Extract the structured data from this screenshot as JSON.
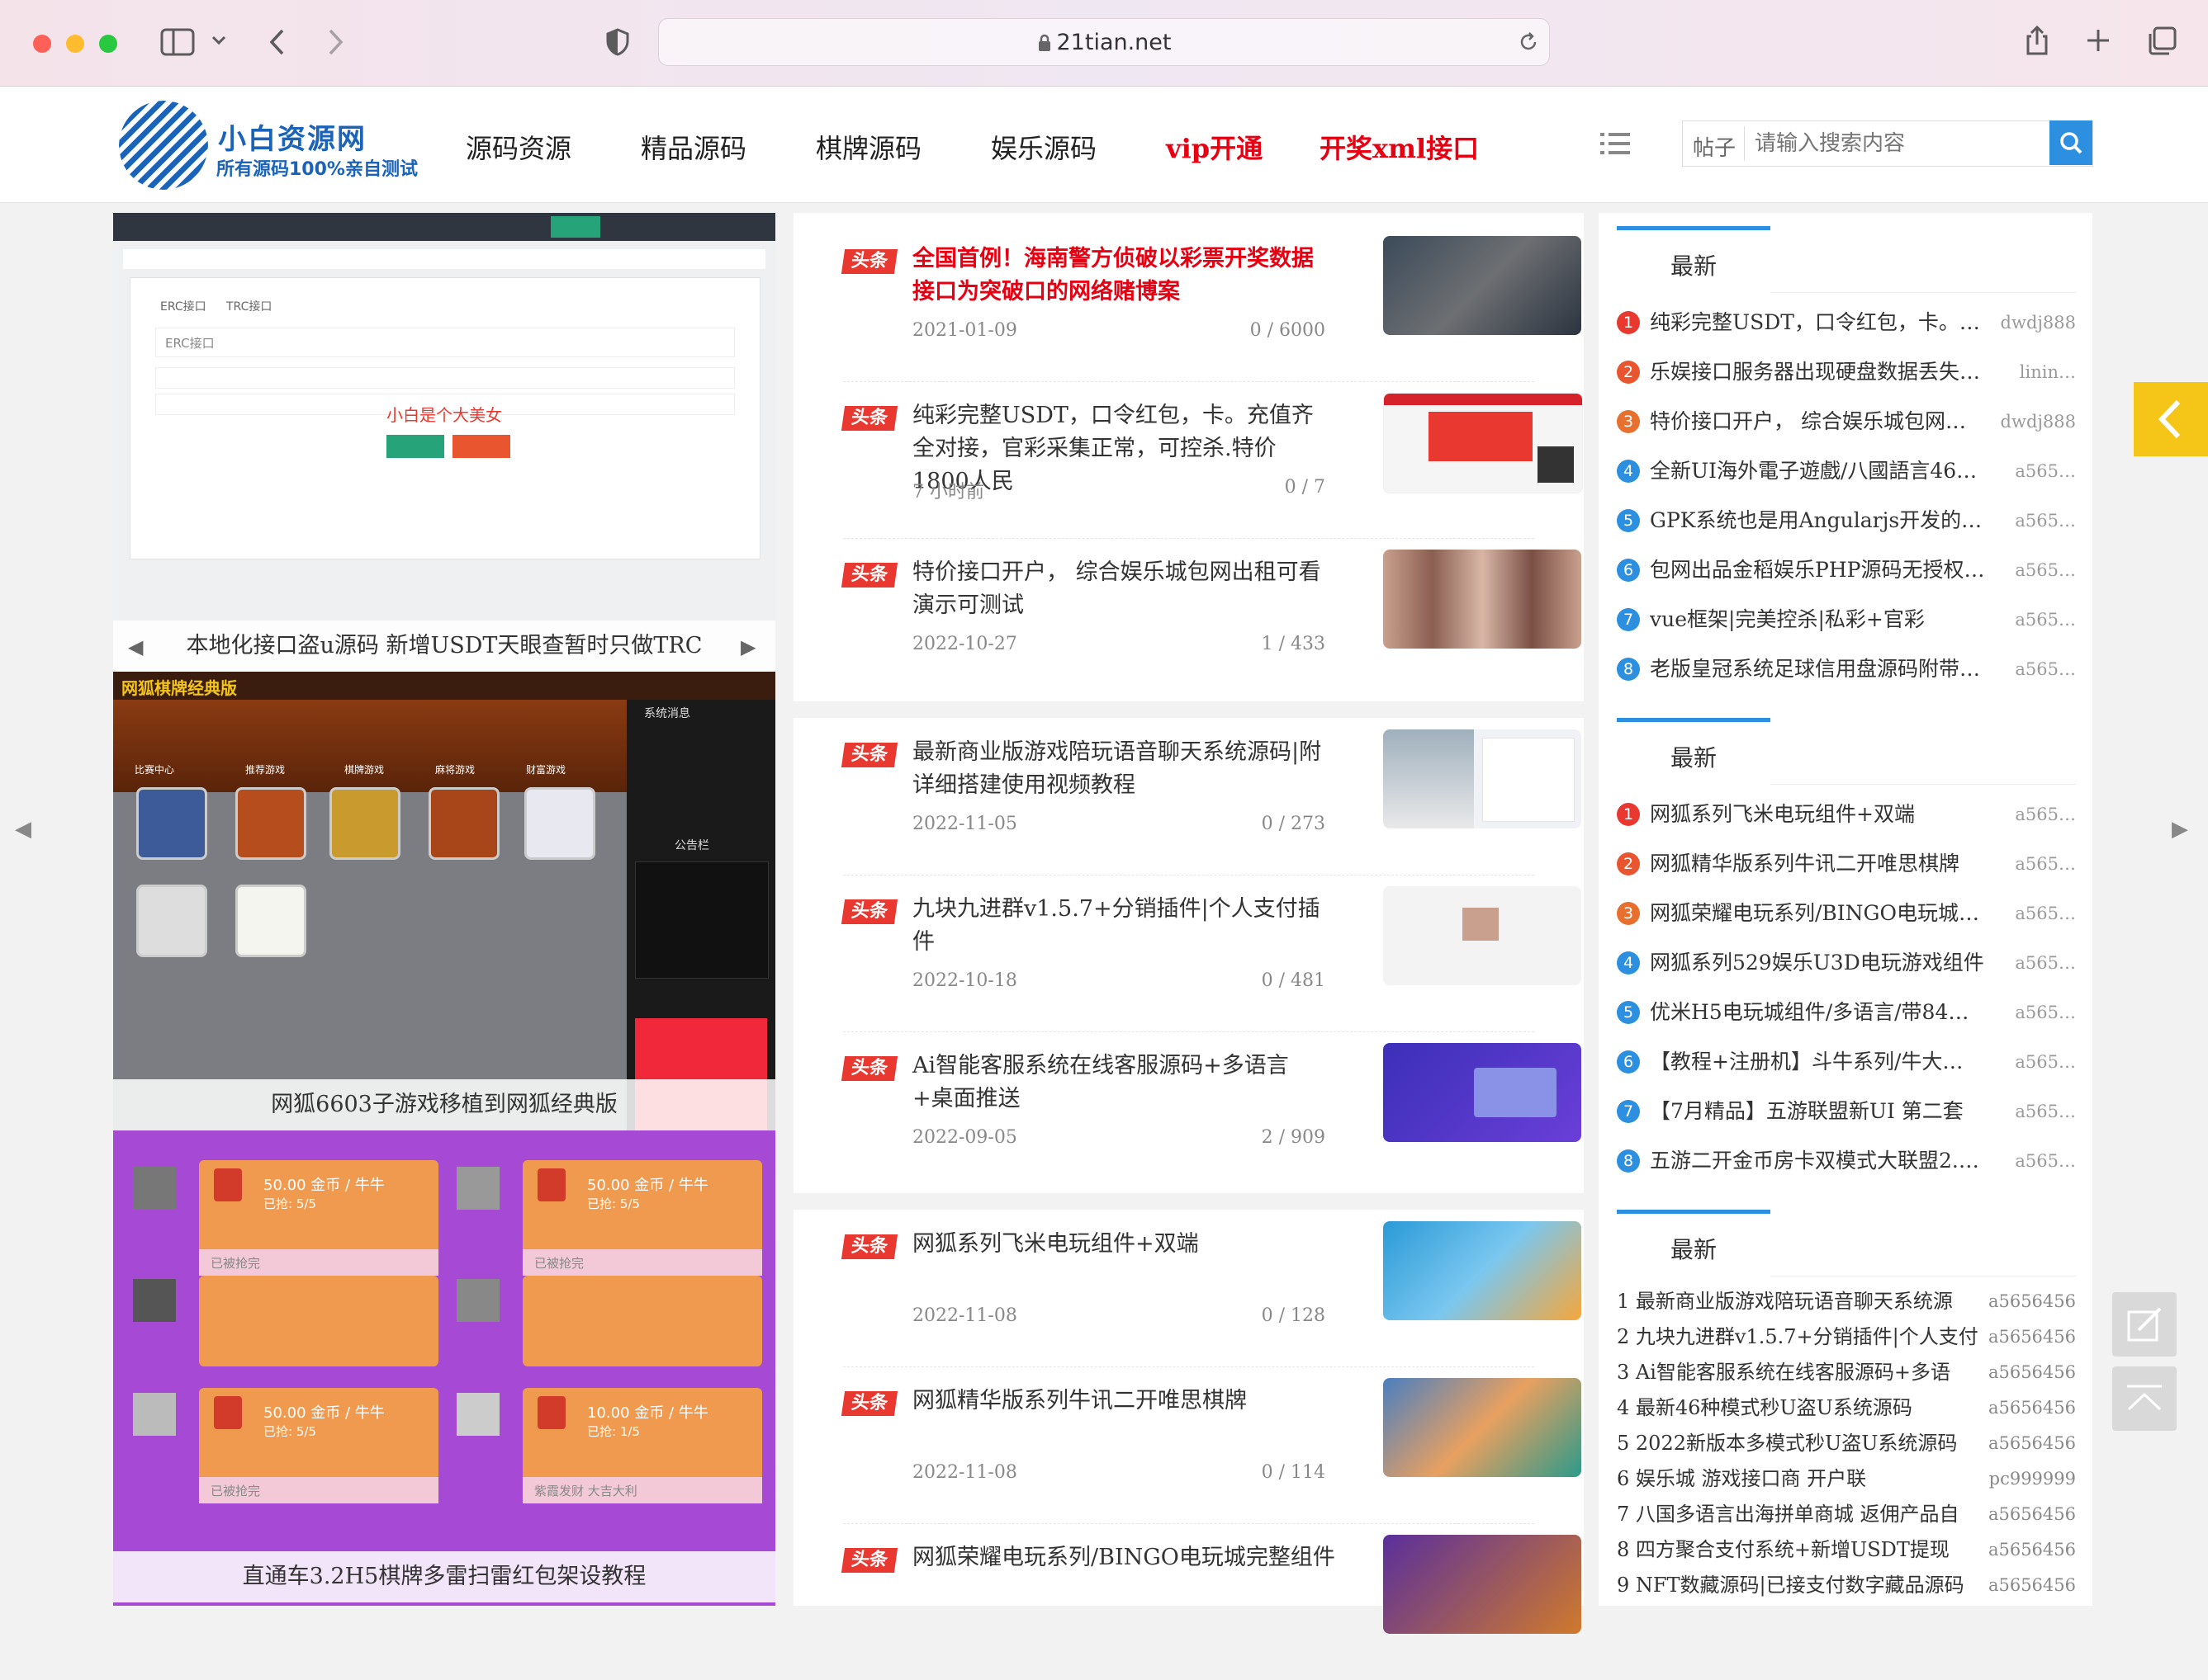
{
  "browser": {
    "url": "21tian.net"
  },
  "site": {
    "logo_title": "小白资源网",
    "logo_sub": "所有源码100%亲自测试",
    "nav": [
      {
        "label": "源码资源",
        "accent": false
      },
      {
        "label": "精品源码",
        "accent": false
      },
      {
        "label": "棋牌源码",
        "accent": false
      },
      {
        "label": "娱乐源码",
        "accent": false
      },
      {
        "label": "vip开通",
        "accent": true
      },
      {
        "label": "开奖xml接口",
        "accent": true
      }
    ],
    "search": {
      "category": "帖子",
      "placeholder": "请输入搜索内容"
    },
    "colors": {
      "brand_blue": "#1a63b8",
      "accent_red": "#e60012",
      "button_blue": "#2d8fe0",
      "tag_red": "#e8382f",
      "float_yellow": "#f5c518"
    }
  },
  "carousel": {
    "slides": [
      {
        "caption": "本地化接口盗u源码 新增USDT天眼查暂时只做TRC"
      },
      {
        "caption": "网狐6603子游戏移植到网狐经典版"
      },
      {
        "caption": "直通车3.2H5棋牌多雷扫雷红包架设教程"
      }
    ],
    "slide1_tabs": [
      "ERC接口",
      "TRC接口"
    ],
    "slide1_field": "ERC接口",
    "slide1_watermark": "小白是个大美女",
    "slide2_header": "网狐棋牌经典版",
    "slide2_cats": [
      "比赛中心",
      "推荐游戏",
      "棋牌游戏",
      "麻将游戏",
      "财富游戏"
    ],
    "slide2_side": [
      "系统消息",
      "公告栏"
    ],
    "slide3_cards": [
      {
        "amount": "50.00 金币 / 牛牛",
        "sub": "已抢: 5/5",
        "status": "已被抢完"
      },
      {
        "amount": "50.00 金币 / 牛牛",
        "sub": "已抢: 5/5",
        "status": "已被抢完"
      },
      {
        "amount": "50.00 金币 / 牛牛",
        "sub": "已抢: 5/5",
        "status": "已被抢完"
      },
      {
        "amount": "10.00 金币 / 牛牛",
        "sub": "已抢: 1/5",
        "status": "紫霞发财 大吉大利"
      }
    ]
  },
  "articles": {
    "tag": "头条",
    "blocks": [
      [
        {
          "title": "全国首例！海南警方侦破以彩票开奖数据接口为突破口的网络赌博案",
          "date": "2021-01-09",
          "stats": "0 / 6000",
          "highlight": true
        },
        {
          "title": "纯彩完整USDT，口令红包，卡。充值齐全对接，官彩采集正常，可控杀.特价1800人民",
          "date": "7 小时前",
          "stats": "0 / 7",
          "highlight": false
        },
        {
          "title": "特价接口开户， 综合娱乐城包网出租可看演示可测试",
          "date": "2022-10-27",
          "stats": "1 / 433",
          "highlight": false
        }
      ],
      [
        {
          "title": "最新商业版游戏陪玩语音聊天系统源码|附详细搭建使用视频教程",
          "date": "2022-11-05",
          "stats": "0 / 273",
          "highlight": false
        },
        {
          "title": "九块九进群v1.5.7+分销插件|个人支付插件",
          "date": "2022-10-18",
          "stats": "0 / 481",
          "highlight": false
        },
        {
          "title": "Ai智能客服系统在线客服源码+多语言+桌面推送",
          "date": "2022-09-05",
          "stats": "2 / 909",
          "highlight": false
        }
      ],
      [
        {
          "title": "网狐系列飞米电玩组件+双端",
          "date": "2022-11-08",
          "stats": "0 / 128",
          "highlight": false
        },
        {
          "title": "网狐精华版系列牛讯二开唯思棋牌",
          "date": "2022-11-08",
          "stats": "0 / 114",
          "highlight": false
        },
        {
          "title": "网狐荣耀电玩系列/BINGO电玩城完整组件",
          "date": "",
          "stats": "",
          "highlight": false
        }
      ]
    ]
  },
  "sidebar": {
    "sections": [
      {
        "title": "最新",
        "items": [
          {
            "rank": "1",
            "title": "纯彩完整USDT，口令红包，卡。…",
            "user": "dwdj888"
          },
          {
            "rank": "2",
            "title": "乐娱接口服务器出现硬盘数据丢失…",
            "user": "linin…"
          },
          {
            "rank": "3",
            "title": "特价接口开户， 综合娱乐城包网…",
            "user": "dwdj888"
          },
          {
            "rank": "4",
            "title": "全新UI海外電子遊戲/八國語言46…",
            "user": "a565…"
          },
          {
            "rank": "5",
            "title": "GPK系统也是用Angularjs开发的二…",
            "user": "a565…"
          },
          {
            "rank": "6",
            "title": "包网出品金稻娱乐PHP源码无授权…",
            "user": "a565…"
          },
          {
            "rank": "7",
            "title": "vue框架|完美控杀|私彩+官彩",
            "user": "a565…"
          },
          {
            "rank": "8",
            "title": "老版皇冠系统足球信用盘源码附带…",
            "user": "a565…"
          }
        ]
      },
      {
        "title": "最新",
        "items": [
          {
            "rank": "1",
            "title": "网狐系列飞米电玩组件+双端",
            "user": "a565…"
          },
          {
            "rank": "2",
            "title": "网狐精华版系列牛讯二开唯思棋牌",
            "user": "a565…"
          },
          {
            "rank": "3",
            "title": "网狐荣耀电玩系列/BINGO电玩城…",
            "user": "a565…"
          },
          {
            "rank": "4",
            "title": "网狐系列529娱乐U3D电玩游戏组件",
            "user": "a565…"
          },
          {
            "rank": "5",
            "title": "优米H5电玩城组件/多语言/带84…",
            "user": "a565…"
          },
          {
            "rank": "6",
            "title": "【教程+注册机】斗牛系列/牛大…",
            "user": "a565…"
          },
          {
            "rank": "7",
            "title": "【7月精品】五游联盟新UI 第二套",
            "user": "a565…"
          },
          {
            "rank": "8",
            "title": "五游二开金币房卡双模式大联盟2.…",
            "user": "a565…"
          }
        ]
      },
      {
        "title": "最新",
        "plain_items": [
          {
            "title": "1 最新商业版游戏陪玩语音聊天系统源",
            "user": "a5656456"
          },
          {
            "title": "2 九块九进群v1.5.7+分销插件|个人支付",
            "user": "a5656456"
          },
          {
            "title": "3 Ai智能客服系统在线客服源码+多语",
            "user": "a5656456"
          },
          {
            "title": "4 最新46种模式秒U盗U系统源码",
            "user": "a5656456"
          },
          {
            "title": "5 2022新版本多模式秒U盗U系统源码",
            "user": "a5656456"
          },
          {
            "title": "6 娱乐城 游戏接口商 开户联",
            "user": "pc999999"
          },
          {
            "title": "7 八国多语言出海拼单商城 返佣产品自",
            "user": "a5656456"
          },
          {
            "title": "8 四方聚合支付系统+新增USDT提现",
            "user": "a5656456"
          },
          {
            "title": "9 NFT数藏源码|已接支付数字藏品源码",
            "user": "a5656456"
          }
        ]
      }
    ],
    "badge_colors": [
      "#e8382f",
      "#e8552f",
      "#e8702f",
      "#2d8fe0"
    ]
  }
}
